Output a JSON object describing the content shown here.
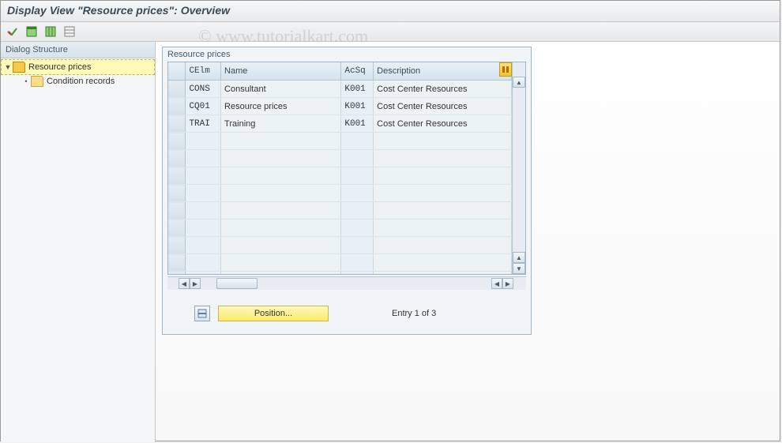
{
  "header": {
    "title": "Display View \"Resource prices\": Overview"
  },
  "toolbar": {
    "select_all_icon": "select-all-icon",
    "table_settings_icon": "table-settings-icon",
    "columns_icon": "columns-icon",
    "export_icon": "export-icon"
  },
  "tree": {
    "heading": "Dialog Structure",
    "root": {
      "label": "Resource prices",
      "expanded": true,
      "selected": true
    },
    "child": {
      "label": "Condition records",
      "expanded": false,
      "selected": false
    }
  },
  "panel": {
    "title": "Resource prices"
  },
  "grid": {
    "columns": {
      "celm": "CElm",
      "name": "Name",
      "acsq": "AcSq",
      "description": "Description"
    },
    "rows": [
      {
        "celm": "CONS",
        "name": "Consultant",
        "acsq": "K001",
        "description": "Cost Center Resources"
      },
      {
        "celm": "CQ01",
        "name": "Resource prices",
        "acsq": "K001",
        "description": "Cost Center Resources"
      },
      {
        "celm": "TRAI",
        "name": "Training",
        "acsq": "K001",
        "description": "Cost Center Resources"
      }
    ],
    "empty_row_count": 9
  },
  "footer": {
    "position_button": "Position...",
    "entry_label": "Entry 1 of 3"
  },
  "watermark": "© www.tutorialkart.com"
}
